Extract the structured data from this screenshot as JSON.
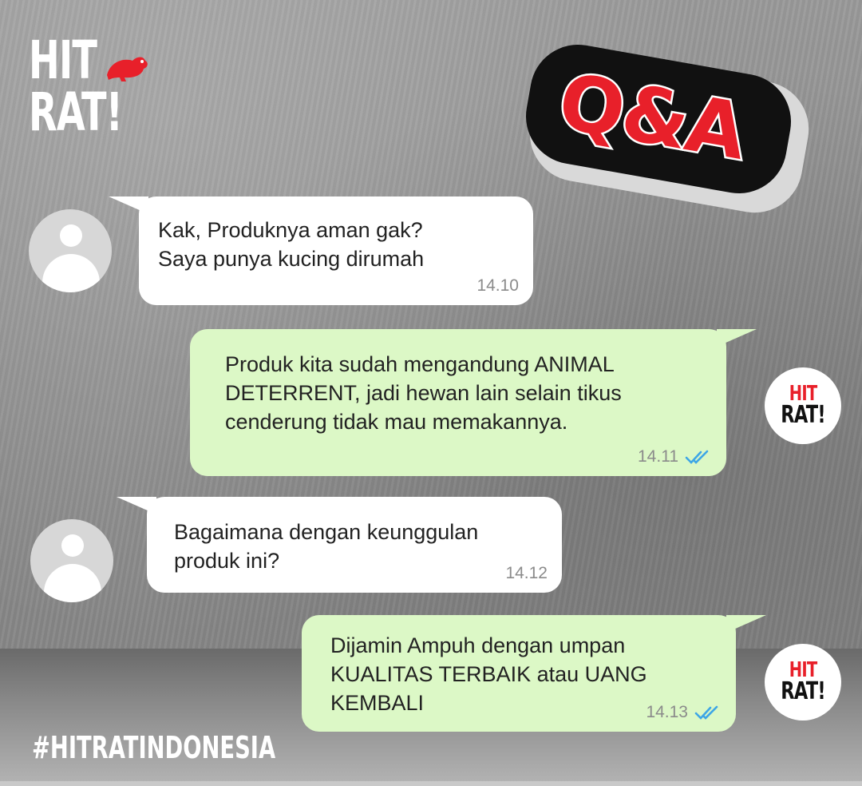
{
  "brand": {
    "logo_line1": "HIT",
    "logo_line2": "RAT!",
    "avatar_line1": "HIT",
    "avatar_line2": "RAT!"
  },
  "badge": {
    "text": "Q&A"
  },
  "colors": {
    "brand_red": "#e8202a",
    "incoming_bubble": "#ffffff",
    "outgoing_bubble": "#dcf8c6",
    "read_tick": "#3ea6e6"
  },
  "messages": [
    {
      "direction": "incoming",
      "text": "Kak, Produknya aman gak?\nSaya punya kucing dirumah",
      "time": "14.10",
      "avatar_icon": "user-placeholder-icon"
    },
    {
      "direction": "outgoing",
      "text": "Produk kita sudah mengandung ANIMAL\nDETERRENT, jadi hewan lain selain tikus\ncenderung tidak mau memakannya.",
      "time": "14.11",
      "status_icon": "double-check-icon"
    },
    {
      "direction": "incoming",
      "text": "Bagaimana dengan keunggulan\nproduk ini?",
      "time": "14.12",
      "avatar_icon": "user-placeholder-icon"
    },
    {
      "direction": "outgoing",
      "text": "Dijamin Ampuh dengan umpan\nKUALITAS TERBAIK atau UANG\nKEMBALI",
      "time": "14.13",
      "status_icon": "double-check-icon"
    }
  ],
  "footer": {
    "hashtag": "#HITRATINDONESIA"
  }
}
